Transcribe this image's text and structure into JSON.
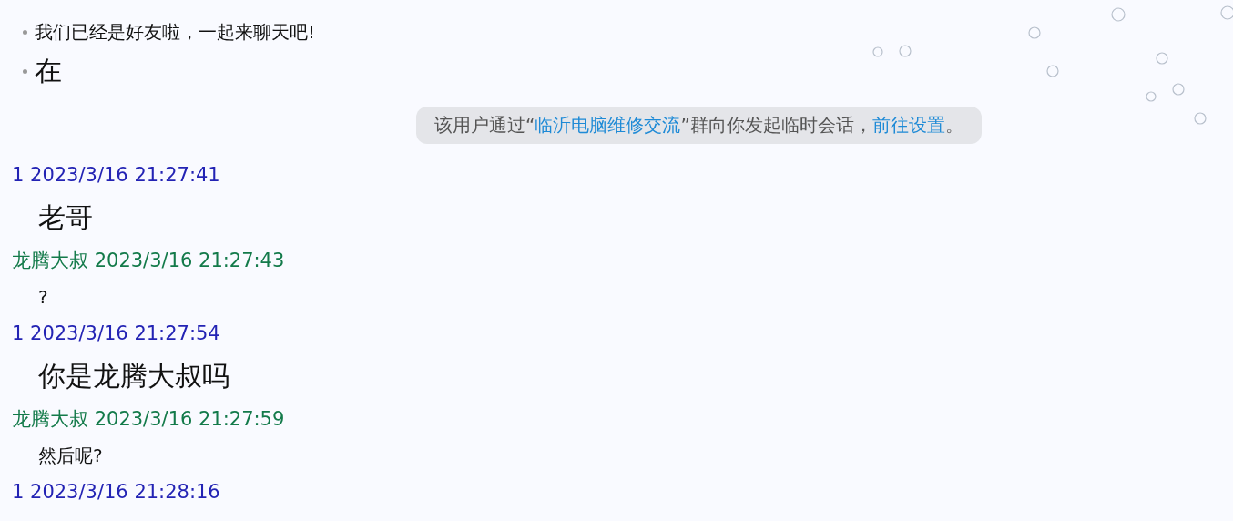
{
  "intro_lines": [
    {
      "text": "我们已经是好友啦，一起来聊天吧!",
      "kind": "normal"
    },
    {
      "text": "在",
      "kind": "large"
    }
  ],
  "system_notice": {
    "text_before": "该用户通过“",
    "group_name": "临沂电脑维修交流",
    "text_after": "”群向你发起临时会话，",
    "link": "前往设置",
    "end": "。"
  },
  "messages": [
    {
      "header": "1 2023/3/16 21:27:41",
      "color": "#2323b4",
      "text": "老哥",
      "kind": "large"
    },
    {
      "header": "龙腾大叔 2023/3/16 21:27:43",
      "color": "#137a4a",
      "text": "?",
      "kind": "normal"
    },
    {
      "header": "1 2023/3/16 21:27:54",
      "color": "#2323b4",
      "text": "你是龙腾大叔吗",
      "kind": "large"
    },
    {
      "header": "龙腾大叔 2023/3/16 21:27:59",
      "color": "#137a4a",
      "text": "然后呢?",
      "kind": "normal"
    }
  ],
  "last_header": {
    "header": "1 2023/3/16 21:28:16",
    "color": "#2323b4"
  }
}
